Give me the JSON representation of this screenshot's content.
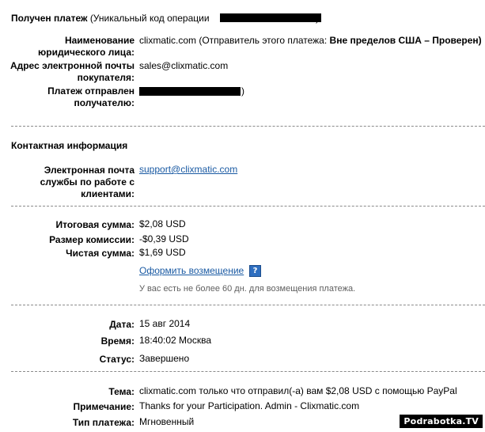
{
  "header": {
    "title": "Получен платеж",
    "op_code_prefix": "(Уникальный код операции",
    "op_code_suffix": ")"
  },
  "payer": {
    "legal_name_label": "Наименование юридического лица:",
    "legal_name_value": "clixmatic.com (Отправитель этого платежа:",
    "legal_name_status": "Вне пределов США – Проверен)",
    "email_label": "Адрес электронной почты покупателя:",
    "email_value": "sales@clixmatic.com",
    "sent_to_label": "Платеж отправлен получателю:",
    "sent_to_suffix": ")"
  },
  "contact": {
    "heading": "Контактная информация",
    "support_label": "Электронная почта службы по работе с клиентами:",
    "support_email": "support@clixmatic.com"
  },
  "amounts": {
    "total_label": "Итоговая сумма:",
    "total_value": "$2,08 USD",
    "fee_label": "Размер комиссии:",
    "fee_value": "-$0,39 USD",
    "net_label": "Чистая сумма:",
    "net_value": "$1,69 USD",
    "refund_link": "Оформить возмещение",
    "help_glyph": "?",
    "refund_note": "У вас есть не более 60 дн. для возмещения платежа."
  },
  "details": {
    "date_label": "Дата:",
    "date_value": "15 авг 2014",
    "time_label": "Время:",
    "time_value": "18:40:02 Москва",
    "status_label": "Статус:",
    "status_value": "Завершено"
  },
  "message": {
    "subject_label": "Тема:",
    "subject_value": "clixmatic.com только что отправил(-а) вам $2,08 USD с помощью PayPal",
    "note_label": "Примечание:",
    "note_value": "Thanks for your Participation. Admin - Clixmatic.com",
    "type_label": "Тип платежа:",
    "type_value": "Мгновенный"
  },
  "watermark": "Podrabotka.TV"
}
